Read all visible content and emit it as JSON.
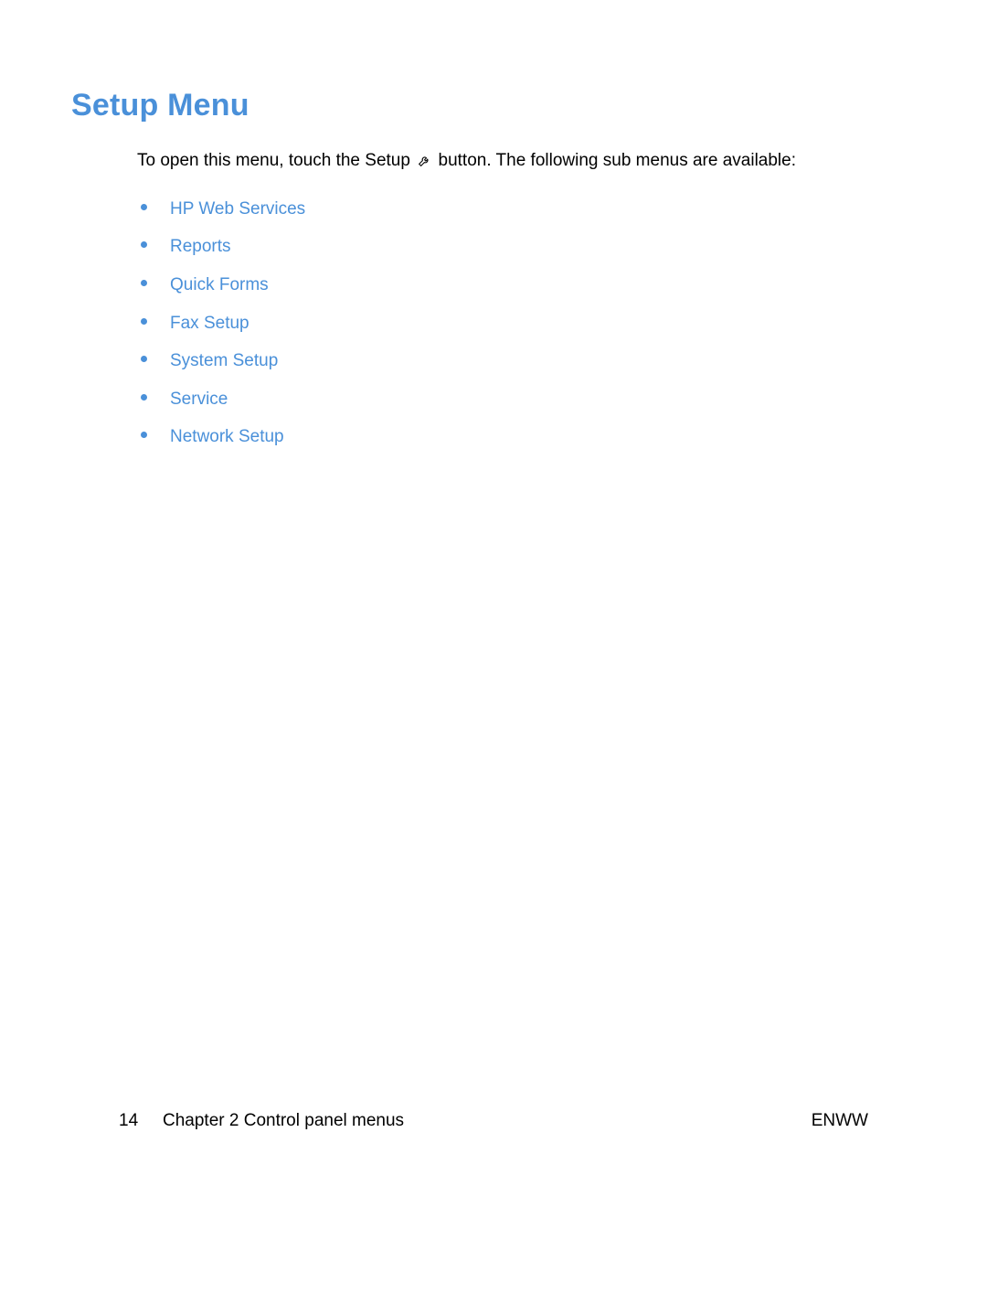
{
  "title": "Setup Menu",
  "intro_prefix": "To open this menu, touch the Setup ",
  "intro_suffix": " button. The following sub menus are available:",
  "menu_items": [
    "HP Web Services",
    "Reports",
    "Quick Forms",
    "Fax Setup",
    "System Setup",
    "Service",
    "Network Setup"
  ],
  "footer": {
    "page_number": "14",
    "chapter_label": "Chapter 2   Control panel menus",
    "right": "ENWW"
  }
}
